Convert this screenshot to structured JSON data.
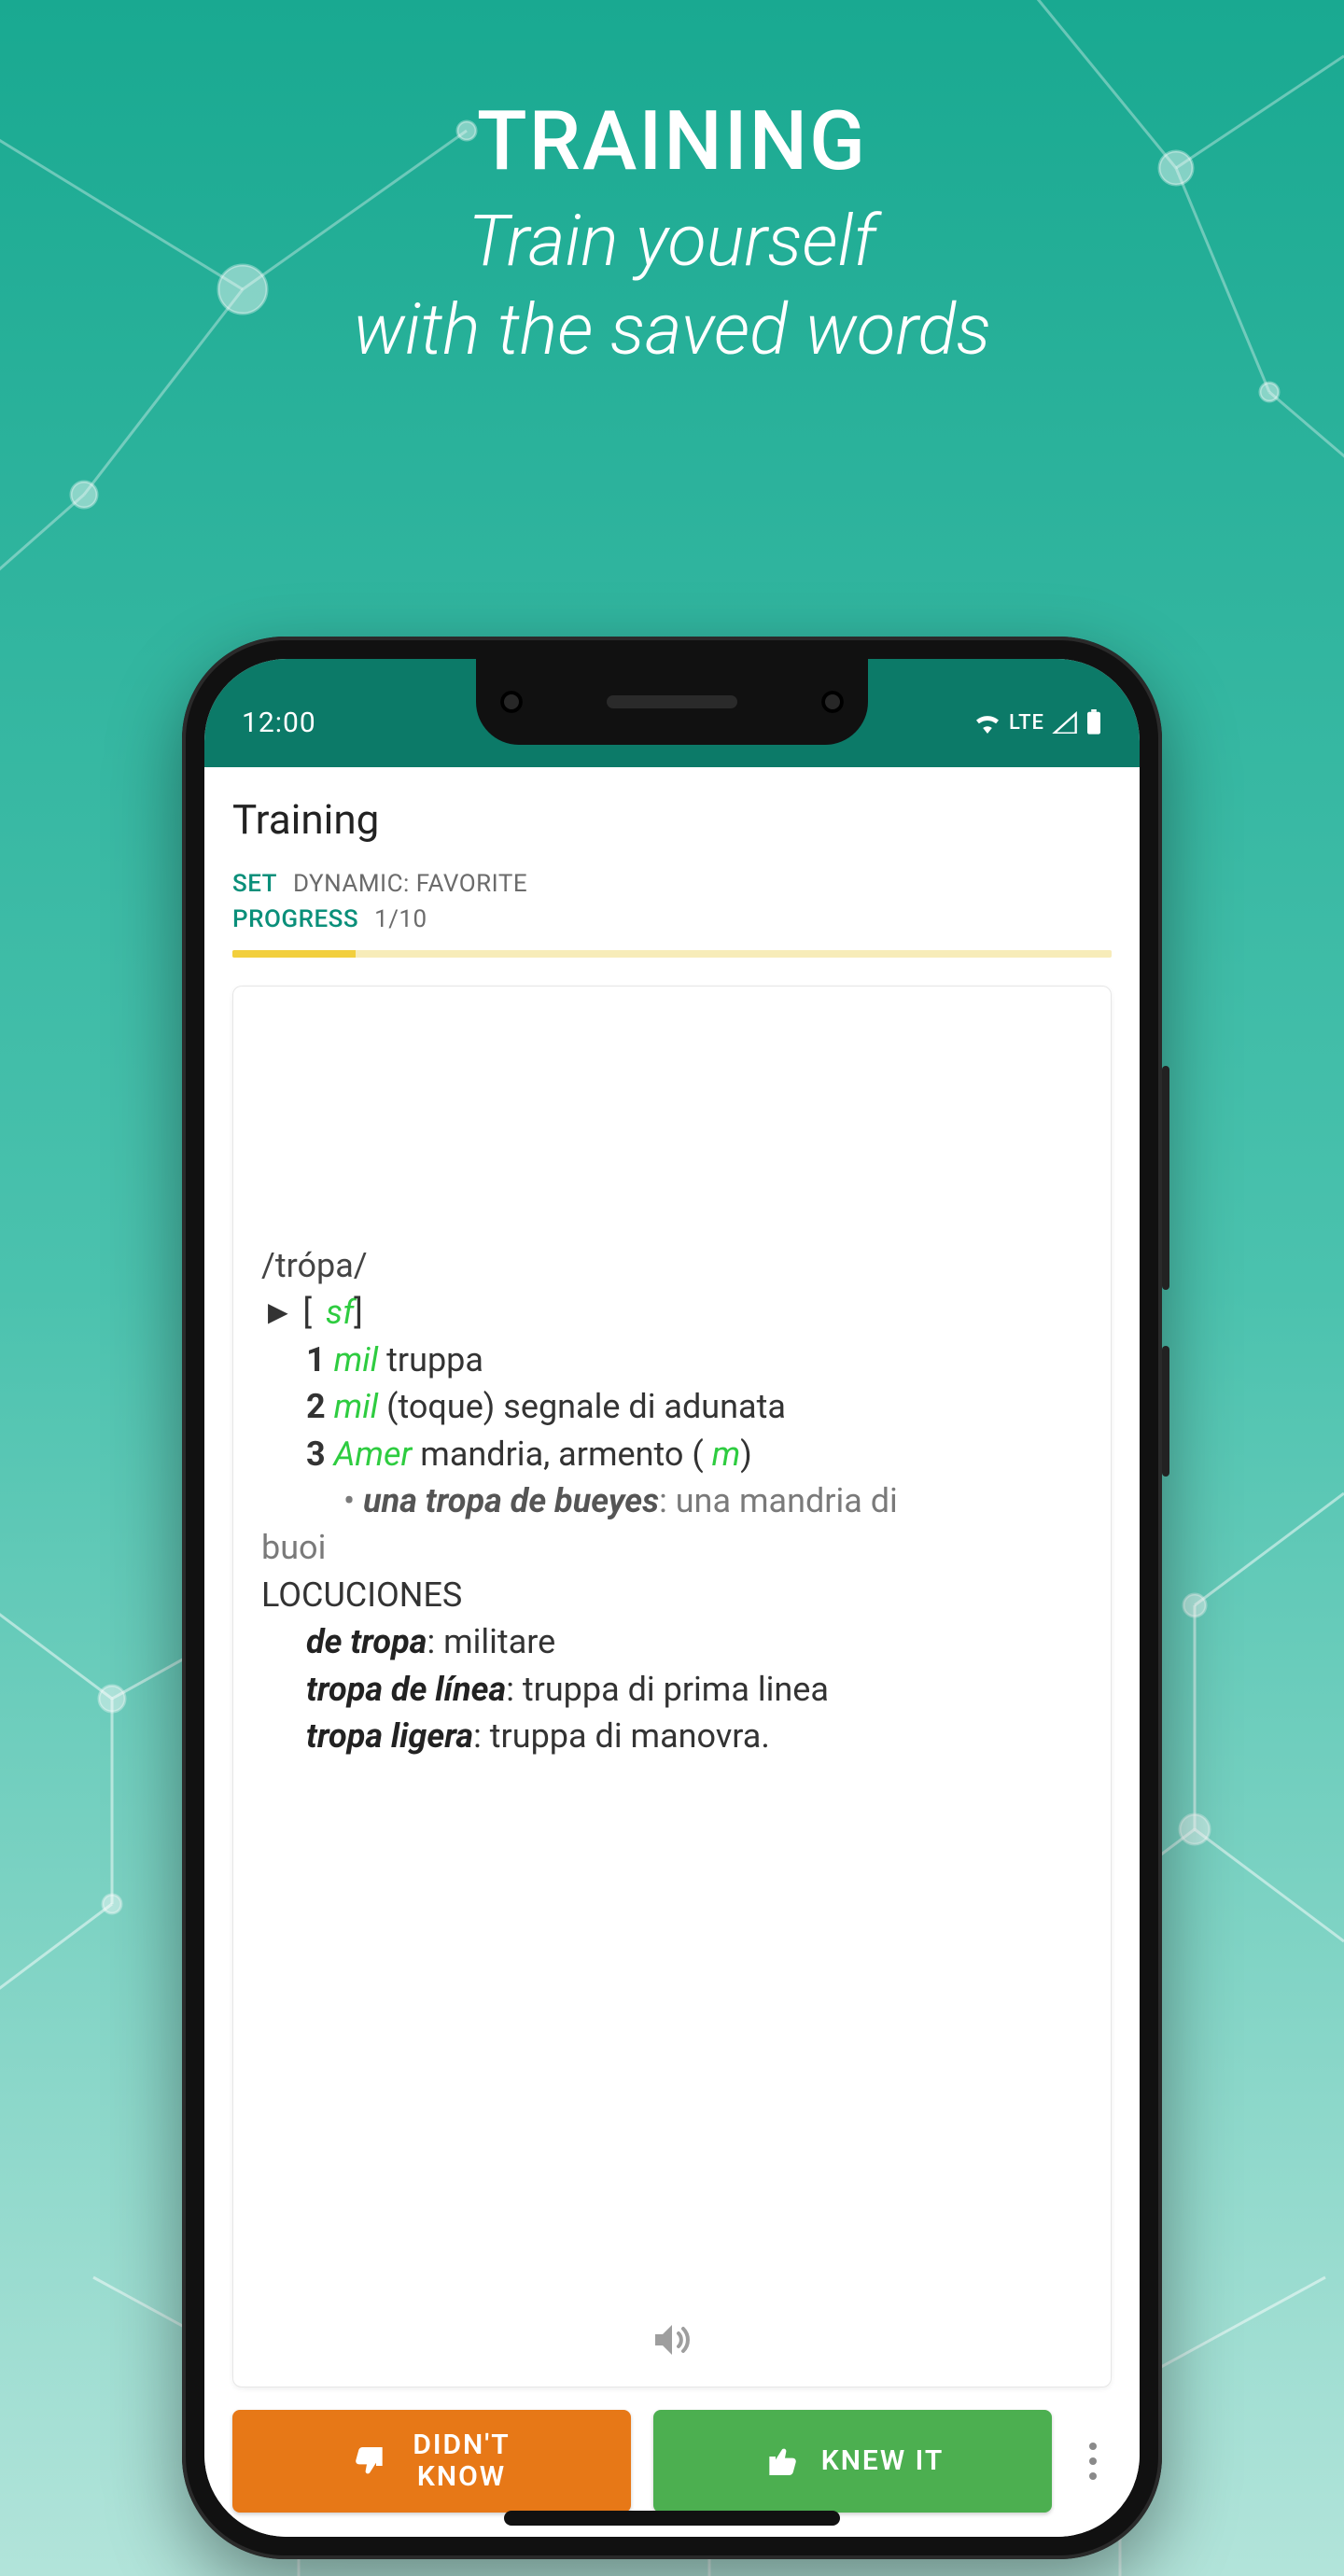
{
  "promo": {
    "title": "TRAINING",
    "subtitle_line1": "Train yourself",
    "subtitle_line2": "with the saved words"
  },
  "status": {
    "time": "12:00",
    "network": "LTE"
  },
  "app": {
    "title": "Training",
    "set_label": "SET",
    "set_value": "DYNAMIC: FAVORITE",
    "progress_label": "PROGRESS",
    "progress_value": "1/10"
  },
  "entry": {
    "pronunciation": "/trópa/",
    "pos_open": "► [ ",
    "pos": "sf",
    "pos_close": "]",
    "def1_num": "1",
    "def1_tag": "mil",
    "def1_text": " truppa",
    "def2_num": "2",
    "def2_tag": "mil",
    "def2_text": " (toque) segnale di adunata",
    "def3_num": "3",
    "def3_tag": "Amer",
    "def3_text": " mandria, armento ( ",
    "def3_m": "m",
    "def3_close": ")",
    "ex_bullet": "• ",
    "ex_bold": "una tropa de bueyes",
    "ex_rest": ": una mandria di",
    "ex_hang": "buoi",
    "loc_header": "LOCUCIONES",
    "loc1_bold": "de tropa",
    "loc1_rest": ": militare",
    "loc2_bold": "tropa de línea",
    "loc2_rest": ": truppa di prima linea",
    "loc3_bold": "tropa ligera",
    "loc3_rest": ": truppa di manovra."
  },
  "actions": {
    "didnt_know": "DIDN'T KNOW",
    "knew_it": "KNEW IT"
  }
}
